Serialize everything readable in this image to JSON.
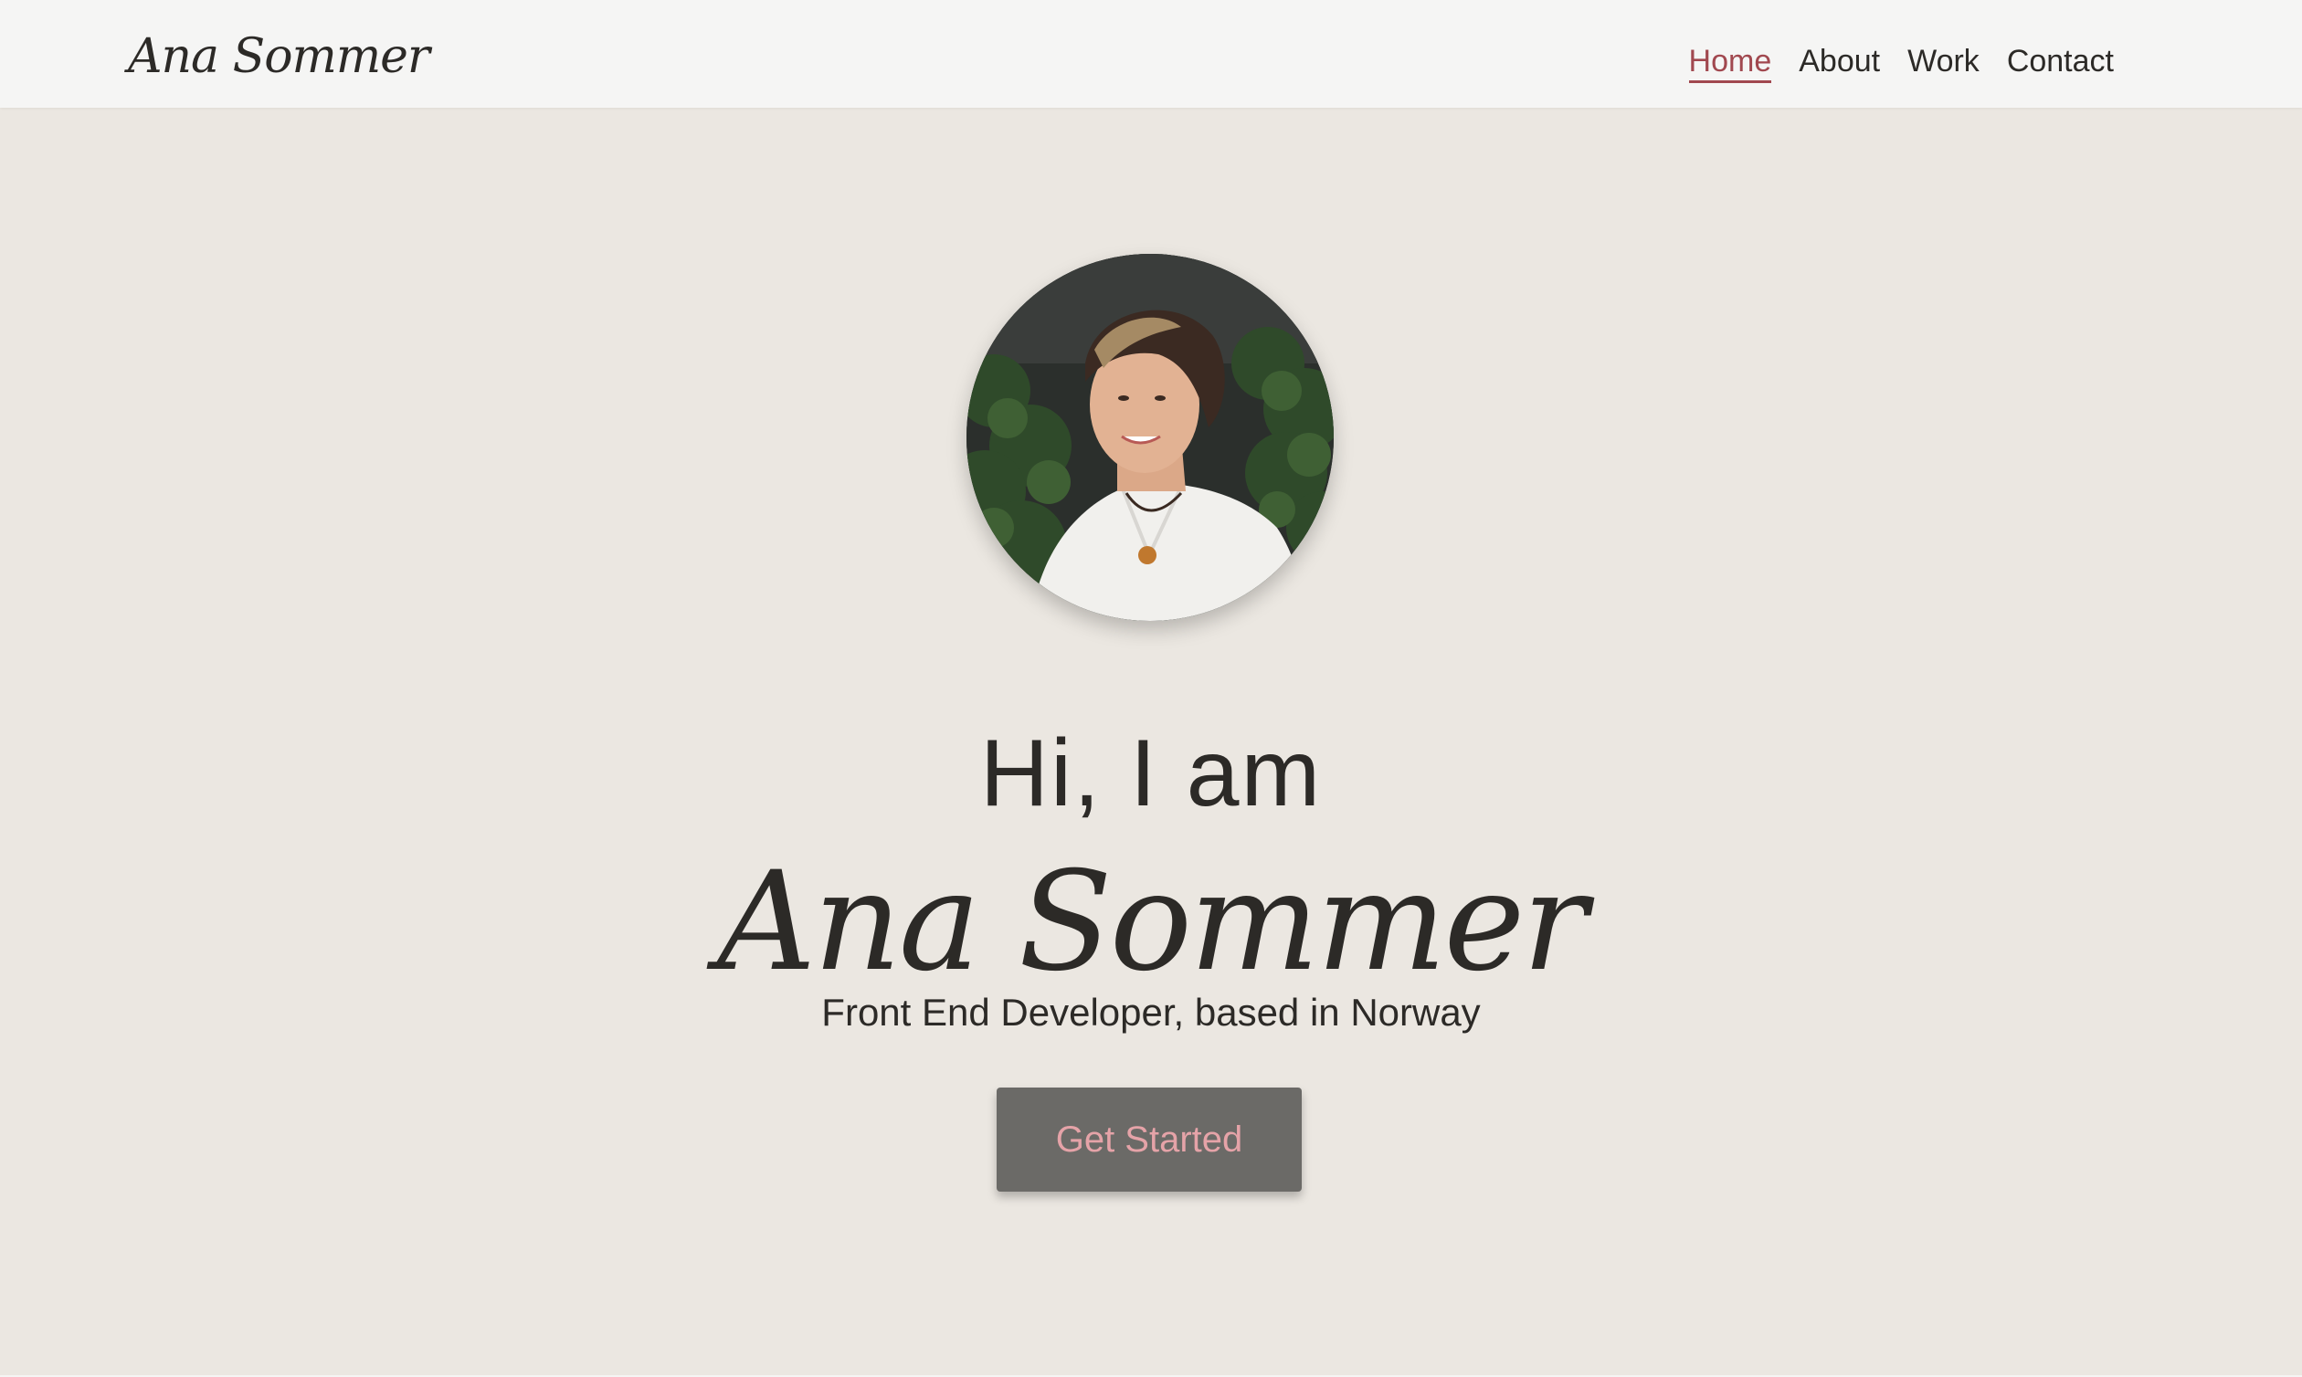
{
  "navbar": {
    "brand": "Ana Sommer",
    "links": [
      {
        "label": "Home",
        "active": true
      },
      {
        "label": "About",
        "active": false
      },
      {
        "label": "Work",
        "active": false
      },
      {
        "label": "Contact",
        "active": false
      }
    ]
  },
  "hero": {
    "greeting": "Hi, I am",
    "name": "Ana Sommer",
    "tagline": "Front End Developer, based in Norway",
    "cta_label": "Get Started"
  },
  "colors": {
    "background": "#ebe7e1",
    "navbar": "#f5f5f4",
    "text": "#2c2a27",
    "accent": "#a1484f",
    "button": "#6b6a67",
    "button_text": "#e5a3a8"
  }
}
